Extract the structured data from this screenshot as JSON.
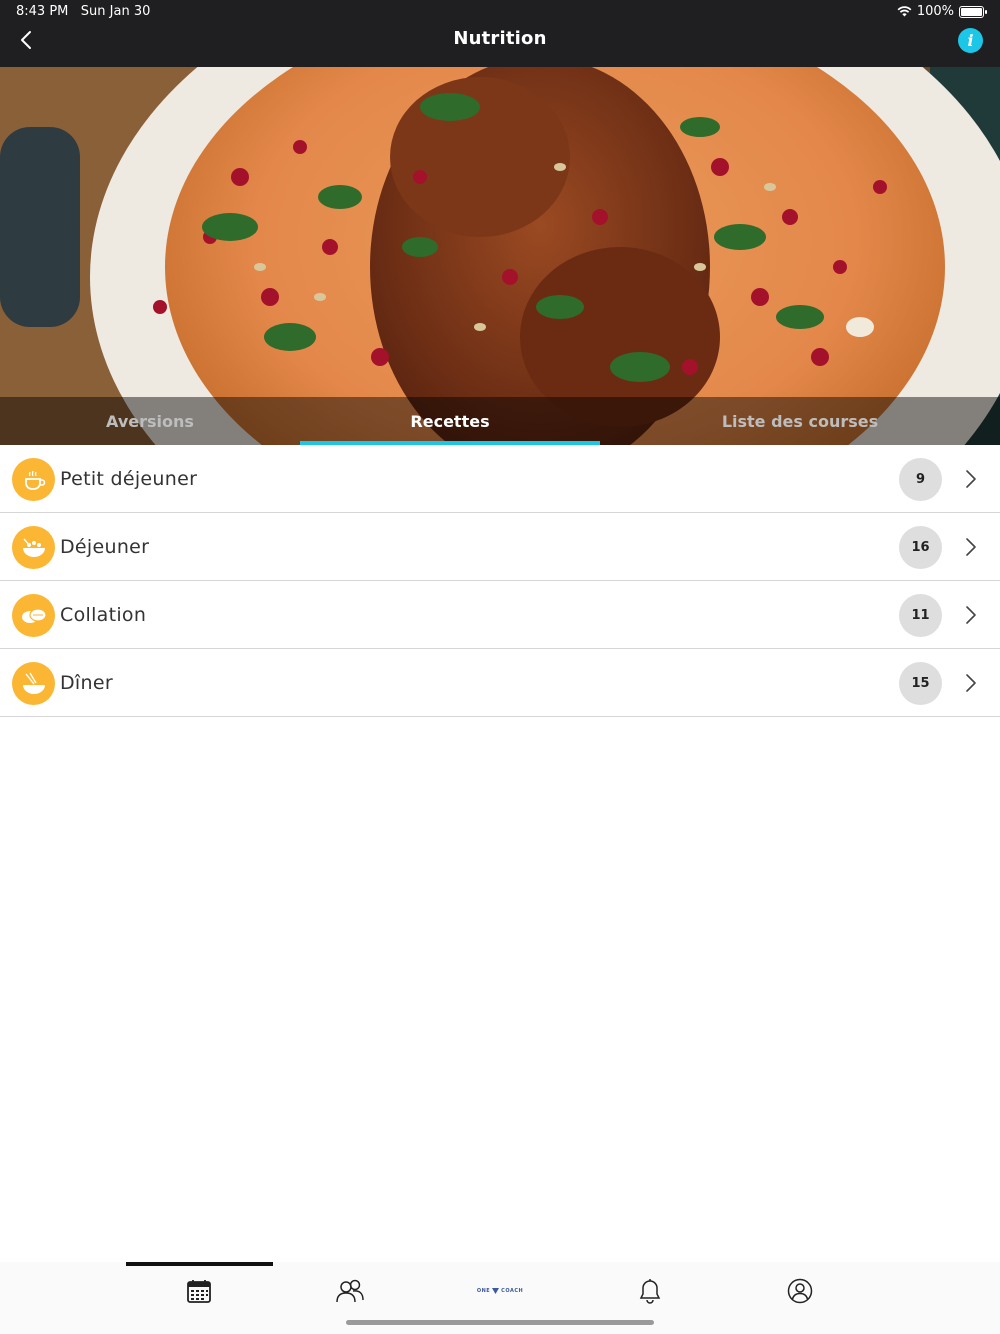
{
  "status": {
    "time": "8:43 PM",
    "date": "Sun Jan 30",
    "battery": "100%"
  },
  "nav": {
    "title": "Nutrition",
    "back_icon": "chevron-left-icon",
    "info_icon": "info-icon",
    "info_glyph": "i"
  },
  "colors": {
    "accent": "#1cc6e6",
    "category_icon_bg": "#fbb634",
    "count_badge_bg": "#dedede",
    "topbar_bg": "#1f1f21"
  },
  "tabs": [
    {
      "label": "Aversions",
      "active": false
    },
    {
      "label": "Recettes",
      "active": true
    },
    {
      "label": "Liste des courses",
      "active": false
    }
  ],
  "categories": [
    {
      "label": "Petit déjeuner",
      "count": "9",
      "icon": "breakfast-cup-icon"
    },
    {
      "label": "Déjeuner",
      "count": "16",
      "icon": "lunch-bowl-icon"
    },
    {
      "label": "Collation",
      "count": "11",
      "icon": "snack-icon"
    },
    {
      "label": "Dîner",
      "count": "15",
      "icon": "dinner-bowl-icon"
    }
  ],
  "tabbar": {
    "items": [
      "calendar-icon",
      "community-icon",
      "onecoach-logo",
      "bell-icon",
      "profile-icon"
    ],
    "logo_left": "ONE",
    "logo_right": "COACH",
    "active_index": 0
  }
}
